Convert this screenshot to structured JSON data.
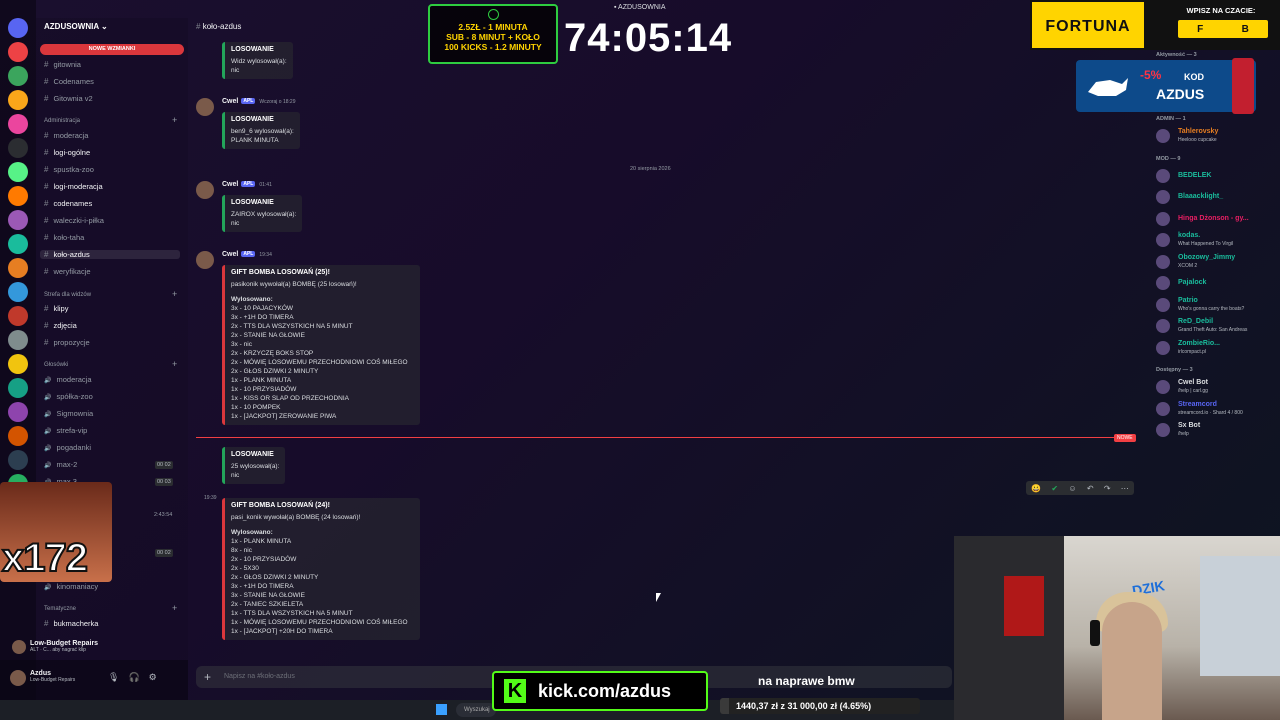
{
  "window_title": "AZDUSOWNIA",
  "server": {
    "name": "AZDUSOWNIA",
    "new_mentions": "NOWE WZMIANKI"
  },
  "top_channels": [
    "gitownia",
    "Codenames",
    "Gitownia v2"
  ],
  "categories": {
    "admin": "Administracja",
    "strefa": "Strefa dla widzów",
    "glosowki": "Głosówki",
    "tematyczne": "Tematyczne"
  },
  "admin_channels": [
    "moderacja",
    "logi-ogólne",
    "spustka-zoo",
    "logi-moderacja",
    "codenames",
    "waleczki-i-piłka",
    "koło-taha",
    "koło-azdus",
    "weryfikacje"
  ],
  "strefa_channels": [
    "klipy",
    "zdjęcia",
    "propozycje"
  ],
  "voice_channels": [
    {
      "name": "moderacja",
      "count": ""
    },
    {
      "name": "spółka-zoo",
      "count": ""
    },
    {
      "name": "Sigmownia",
      "count": ""
    },
    {
      "name": "strefa-vip",
      "count": ""
    },
    {
      "name": "pogadanki",
      "count": ""
    },
    {
      "name": "max-2",
      "count": "00 02"
    },
    {
      "name": "max 3",
      "count": "00 03"
    }
  ],
  "voice_misc": {
    "timer": "2:43:54",
    "count4": "00 02",
    "kinomaniacy": "kinomaniacy"
  },
  "tematyczne_channels": [
    "bukmacherka"
  ],
  "voice_status": {
    "title": "Low-Budget Repairs",
    "sub": "ALT · C... aby nagrać klip"
  },
  "user": {
    "name": "Azdus",
    "status": "Low-Budget Repairs"
  },
  "current_channel": "koło-azdus",
  "messages": [
    {
      "author": "",
      "tag": "",
      "time": "",
      "embed_title": "LOSOWANIE",
      "lines": [
        "Widz wylosował(a):",
        "nic"
      ]
    },
    {
      "author": "Cwel",
      "tag": "APL",
      "time": "Wczoraj o 18:29",
      "embed_title": "LOSOWANIE",
      "lines": [
        "ben9_6 wylosował(a):",
        "PLANK MINUTA"
      ]
    },
    {
      "author": "Cwel",
      "tag": "APL",
      "time": "01:41",
      "embed_title": "LOSOWANIE",
      "lines": [
        "ZAIROX wylosował(a):",
        "nic"
      ]
    },
    {
      "author": "Cwel",
      "tag": "APL",
      "time": "19:34",
      "embed_title": "GIFT BOMBA LOSOWAŃ (25)!",
      "lines": [
        "pasikonik wywołał(a) BOMBĘ (25 losowań)!",
        "",
        "Wylosowano:",
        "3x - 10 PAJACYKÓW",
        "3x - +1H DO TIMERA",
        "2x - TTS DLA WSZYSTKICH NA 5 MINUT",
        "2x - STANIE NA GŁOWIE",
        "3x - nic",
        "2x - KRZYCZĘ BOKS STOP",
        "2x - MÓWIĘ LOSOWEMU PRZECHODNIOWI COŚ MIŁEGO",
        "2x - GŁOS DZIWKI 2 MINUTY",
        "1x - PLANK MINUTA",
        "1x - 10 PRZYSIADÓW",
        "1x - KISS OR SLAP OD PRZECHODNIA",
        "1x - 10 POMPEK",
        "1x - [JACKPOT] ZEROWANIE PIWA"
      ]
    },
    {
      "author": "",
      "tag": "",
      "time": "",
      "embed_title": "LOSOWANIE",
      "lines": [
        "25 wylosował(a):",
        "nic"
      ]
    },
    {
      "author": "",
      "tag": "",
      "time": "19:39",
      "embed_title": "GIFT BOMBA LOSOWAŃ (24)!",
      "lines": [
        "pasi_konik wywołał(a) BOMBĘ (24 losowań)!",
        "",
        "Wylosowano:",
        "1x - PLANK MINUTA",
        "8x - nic",
        "2x - 10 PRZYSIADÓW",
        "2x - 5X30",
        "2x - GŁOS DZIWKI 2 MINUTY",
        "3x - +1H DO TIMERA",
        "3x - STANIE NA GŁOWIE",
        "2x - TANIEC SZKIELETA",
        "1x - TTS DLA WSZYSTKICH NA 5 MINUT",
        "1x - MÓWIĘ LOSOWEMU PRZECHODNIOWI COŚ MIŁEGO",
        "1x - [JACKPOT] +20H DO TIMERA"
      ]
    }
  ],
  "date_separator": "20 sierpnia 2026",
  "new_label": "NOWE",
  "composer_placeholder": "Napisz na #koło-azdus",
  "overlay": {
    "timer_lines": [
      "2.5ZŁ - 1 MINUTA",
      "SUB - 8 MINUT + KOŁO",
      "100 KICKS - 1.2 MINUTY"
    ],
    "big_timer": "74:05:14",
    "fortuna": "FORTUNA",
    "fortuna_prompt": "WPISZ NA CZACIE:",
    "fortuna_keys": [
      "F",
      "B"
    ],
    "dzik_pct": "-5%",
    "dzik_kod": "KOD",
    "dzik_code": "AZDUS",
    "dzik_brand": "DZIK",
    "multiplier": "x172",
    "kick_url": "kick.com/azdus",
    "goal_label": "na naprawe bmw",
    "goal_text": "1440,37 zł z 31 000,00 zł (4.65%)",
    "goal_fraction": 0.0465,
    "taskbar_search": "Wyszukaj"
  },
  "members": {
    "activity": "Aktywność — 3",
    "groups": [
      {
        "header": "ADMIN — 1",
        "rows": [
          {
            "name": "Tahlerovsky",
            "status": "Heelooo cupcake",
            "color": "#e67e22"
          }
        ]
      },
      {
        "header": "MOD — 9",
        "rows": [
          {
            "name": "BEDELEK",
            "status": "",
            "color": "#1abc9c"
          },
          {
            "name": "Blaaacklight_",
            "status": "",
            "color": "#1abc9c"
          },
          {
            "name": "Hinga Dżonson - gy...",
            "status": "",
            "color": "#e91e63"
          },
          {
            "name": "kodas.",
            "status": "What Happened To Virgil",
            "color": "#1abc9c"
          },
          {
            "name": "Obozowy_Jimmy",
            "status": "XCOM 2",
            "color": "#1abc9c"
          },
          {
            "name": "Pajalock",
            "status": "",
            "color": "#1abc9c"
          },
          {
            "name": "Patrio",
            "status": "Who's gonna carry the boats?",
            "color": "#1abc9c"
          },
          {
            "name": "ReD_Debil",
            "status": "Grand Theft Auto: San Andreas",
            "color": "#1abc9c"
          },
          {
            "name": "ZombieRio...",
            "status": "irlcompact.pl",
            "color": "#1abc9c"
          }
        ]
      },
      {
        "header": "Dostępny — 3",
        "rows": [
          {
            "name": "Cwel Bot",
            "status": "/help | carl.gg",
            "color": "#dbdee1"
          },
          {
            "name": "Streamcord",
            "status": "streamcord.io · Shard 4 / 800",
            "color": "#5865f2"
          },
          {
            "name": "Sx Bot",
            "status": "/help",
            "color": "#dbdee1"
          }
        ]
      }
    ]
  }
}
